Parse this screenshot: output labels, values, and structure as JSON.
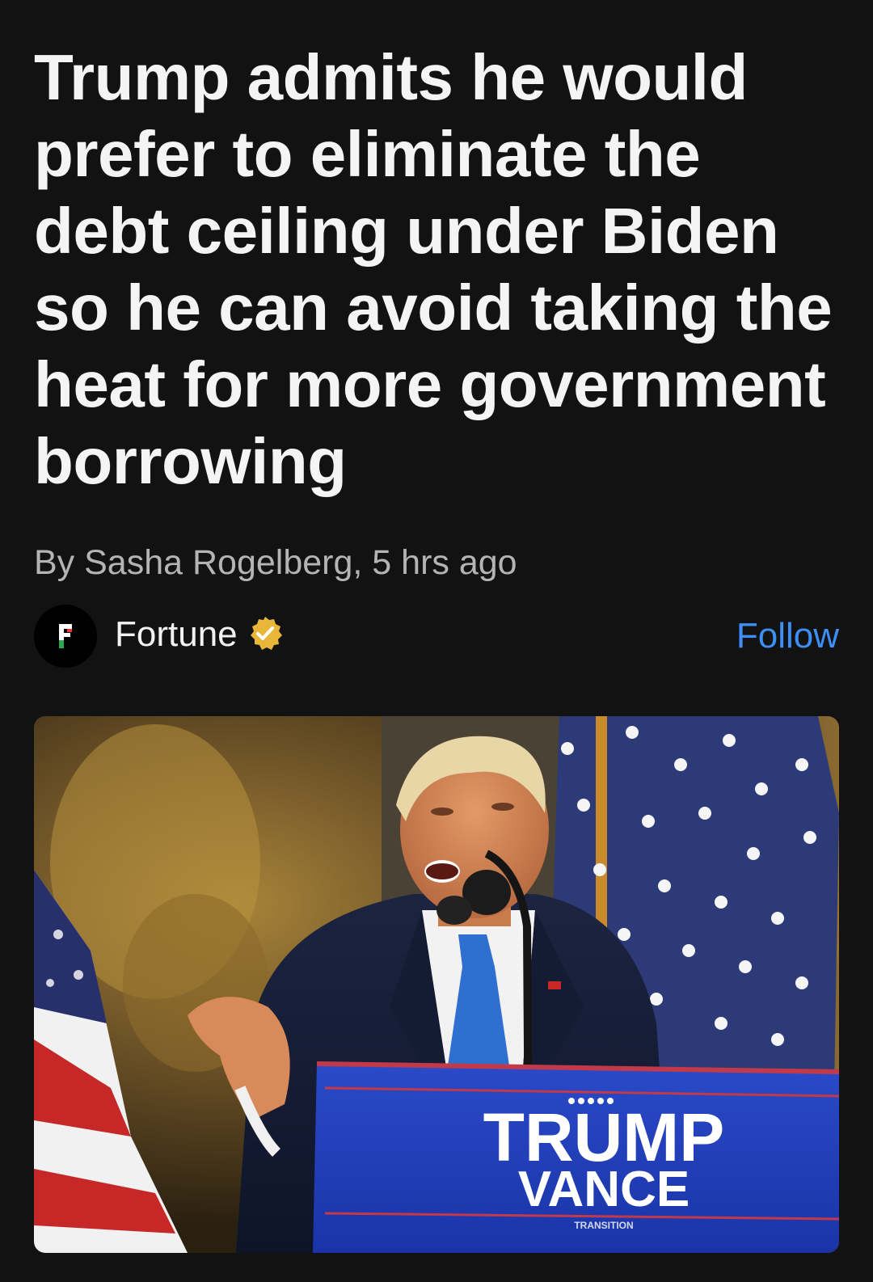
{
  "article": {
    "headline": "Trump admits he would prefer to eliminate the debt ceiling under Biden so he can avoid taking the heat for more government borrowing",
    "byline": "By Sasha Rogelberg, 5 hrs ago"
  },
  "source": {
    "name": "Fortune",
    "logo_letter": "F",
    "verified": true,
    "follow_label": "Follow"
  },
  "image": {
    "podium_line1": "TRUMP",
    "podium_line2": "VANCE",
    "podium_line3": "TRANSITION"
  },
  "colors": {
    "background": "#121212",
    "headline": "#f4f4f4",
    "byline": "#b4b4b4",
    "follow": "#3d8ef5",
    "verified_badge": "#e8b73a"
  }
}
